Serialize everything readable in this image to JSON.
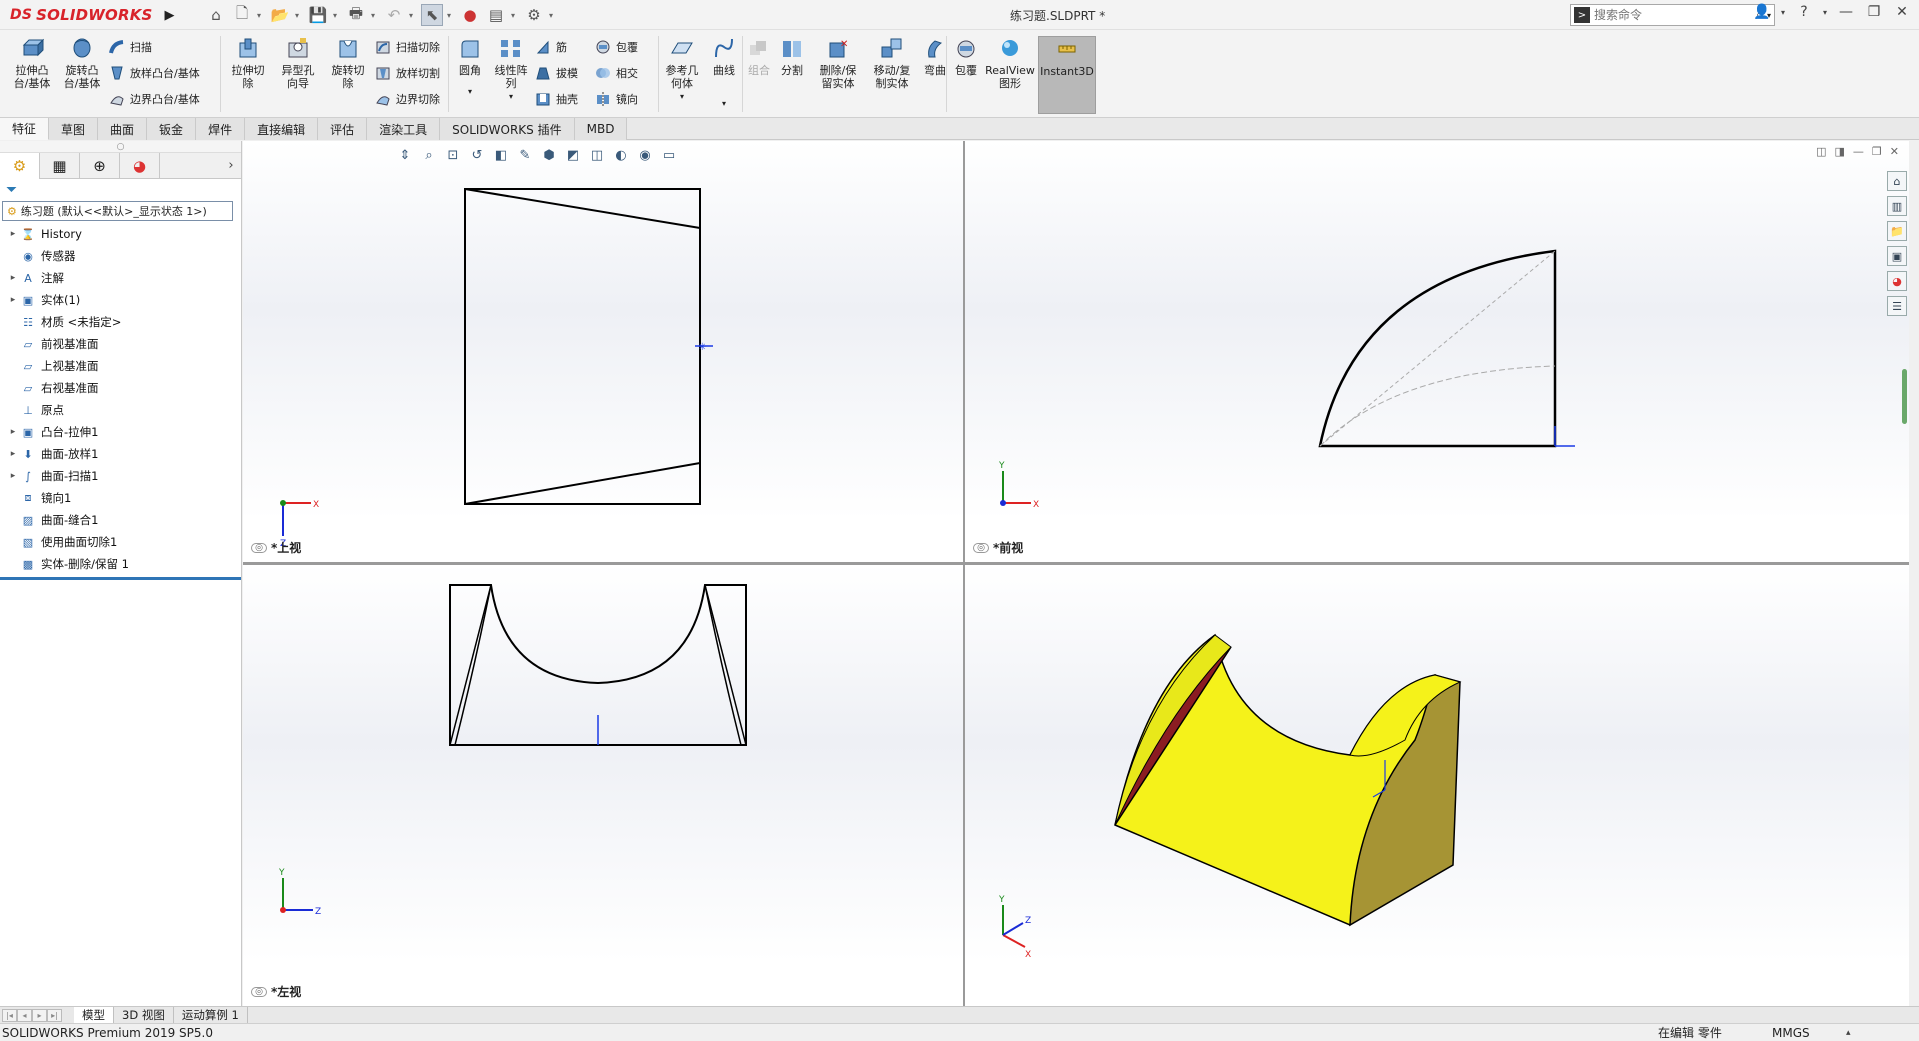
{
  "titlebar": {
    "logo_text": "SOLIDWORKS",
    "logo_mark": "DS",
    "document_title": "练习题.SLDPRT *",
    "search_placeholder": "搜索命令",
    "help_mark": "?",
    "menu_arrow": "▶"
  },
  "ribbon": {
    "boss_extrude": "拉伸凸\n台/基体",
    "revolve_boss": "旋转凸\n台/基体",
    "sweep": "扫描",
    "loft_boss": "放样凸台/基体",
    "boundary_boss": "边界凸台/基体",
    "extrude_cut": "拉伸切\n除",
    "hole_wizard": "异型孔\n向导",
    "revolve_cut": "旋转切\n除",
    "swept_cut": "扫描切除",
    "lofted_cut": "放样切割",
    "boundary_cut": "边界切除",
    "fillet": "圆角",
    "linear_pattern": "线性阵\n列",
    "rib": "筋",
    "draft": "拔模",
    "shell": "抽壳",
    "wrap": "包覆",
    "intersect": "相交",
    "mirror": "镜向",
    "ref_geometry": "参考几\n何体",
    "curves": "曲线",
    "combine": "组合",
    "split": "分割",
    "delete_body": "删除/保\n留实体",
    "move_copy": "移动/复\n制实体",
    "flex": "弯曲",
    "wrap2": "包覆",
    "realview": "RealView\n图形",
    "instant3d": "Instant3D"
  },
  "tabs": [
    "特征",
    "草图",
    "曲面",
    "钣金",
    "焊件",
    "直接编辑",
    "评估",
    "渲染工具",
    "SOLIDWORKS 插件",
    "MBD"
  ],
  "tree": {
    "root": "练习题  (默认<<默认>_显示状态 1>)",
    "items": [
      {
        "label": "History",
        "expand": "▸",
        "icon": "history-icon"
      },
      {
        "label": "传感器",
        "expand": "",
        "icon": "sensor-icon"
      },
      {
        "label": "注解",
        "expand": "▸",
        "icon": "annotation-icon"
      },
      {
        "label": "实体(1)",
        "expand": "▸",
        "icon": "solid-body-icon"
      },
      {
        "label": "材质 <未指定>",
        "expand": "",
        "icon": "material-icon"
      },
      {
        "label": "前视基准面",
        "expand": "",
        "icon": "plane-icon"
      },
      {
        "label": "上视基准面",
        "expand": "",
        "icon": "plane-icon"
      },
      {
        "label": "右视基准面",
        "expand": "",
        "icon": "plane-icon"
      },
      {
        "label": "原点",
        "expand": "",
        "icon": "origin-icon"
      },
      {
        "label": "凸台-拉伸1",
        "expand": "▸",
        "icon": "extrude-icon"
      },
      {
        "label": "曲面-放样1",
        "expand": "▸",
        "icon": "loft-icon"
      },
      {
        "label": "曲面-扫描1",
        "expand": "▸",
        "icon": "sweep-icon"
      },
      {
        "label": "镜向1",
        "expand": "",
        "icon": "mirror-icon"
      },
      {
        "label": "曲面-缝合1",
        "expand": "",
        "icon": "knit-icon"
      },
      {
        "label": "使用曲面切除1",
        "expand": "",
        "icon": "surface-cut-icon"
      },
      {
        "label": "实体-删除/保留 1",
        "expand": "",
        "icon": "delete-body-icon"
      }
    ]
  },
  "viewports": {
    "top": "*上视",
    "front": "*前视",
    "left": "*左视"
  },
  "bottom_tabs": [
    "模型",
    "3D 视图",
    "运动算例 1"
  ],
  "status": {
    "version": "SOLIDWORKS Premium 2019 SP5.0",
    "editing": "在编辑 零件",
    "units": "MMGS"
  },
  "colors": {
    "brand": "#d8232a",
    "part_yellow": "#f5f21a",
    "part_dark_yellow": "#a69434",
    "section_red": "#8b1c22",
    "tree_highlight": "#2e75b6"
  }
}
